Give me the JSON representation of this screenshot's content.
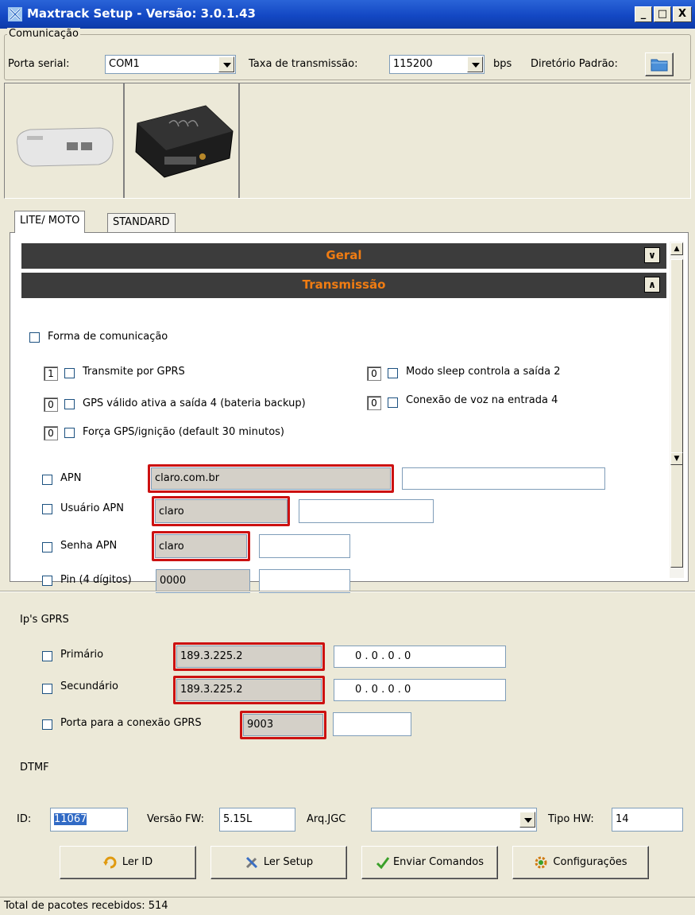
{
  "window": {
    "title": "Maxtrack Setup - Versão: 3.0.1.43",
    "min": "_",
    "max": "□",
    "close": "X"
  },
  "comm": {
    "legend": "Comunicação",
    "porta_label": "Porta serial:",
    "porta_value": "COM1",
    "taxa_label": "Taxa de transmissão:",
    "taxa_value": "115200",
    "bps": "bps",
    "diretorio_label": "Diretório Padrão:"
  },
  "tabs": [
    "LITE/ MOTO",
    "STANDARD"
  ],
  "sections": {
    "geral": "Geral",
    "transmissao": "Transmissão"
  },
  "form": {
    "forma_label": "Forma de comunicação",
    "opts": {
      "gprs": {
        "num": "1",
        "label": "Transmite por GPRS"
      },
      "sleep": {
        "num": "0",
        "label": "Modo sleep controla a saída 2"
      },
      "gps": {
        "num": "0",
        "label": "GPS válido ativa a saída 4 (bateria backup)"
      },
      "voz": {
        "num": "0",
        "label": "Conexão de voz na entrada 4"
      },
      "forca": {
        "num": "0",
        "label": "Força GPS/ignição (default 30 minutos)"
      }
    },
    "apn": {
      "label": "APN",
      "value": "claro.com.br",
      "new": ""
    },
    "usuario": {
      "label": "Usuário APN",
      "value": "claro",
      "new": ""
    },
    "senha": {
      "label": "Senha APN",
      "value": "claro",
      "new": ""
    },
    "pin": {
      "label": "Pin (4 dígitos)",
      "value": "0000",
      "new": ""
    },
    "ips_label": "Ip's GPRS",
    "primario": {
      "label": "Primário",
      "value": "189.3.225.2",
      "new": "0  .  0  .  0  .  0"
    },
    "secundario": {
      "label": "Secundário",
      "value": "189.3.225.2",
      "new": "0  .  0  .  0  .  0"
    },
    "porta": {
      "label": "Porta para a conexão GPRS",
      "value": "9003",
      "new": ""
    },
    "dtmf_label": "DTMF"
  },
  "bottom": {
    "id_label": "ID:",
    "id_value": "11067",
    "fw_label": "Versão FW:",
    "fw_value": "5.15L",
    "jgc_label": "Arq.JGC",
    "jgc_value": "",
    "hw_label": "Tipo HW:",
    "hw_value": "14",
    "buttons": {
      "ler_id": "Ler ID",
      "ler_setup": "Ler Setup",
      "enviar": "Enviar Comandos",
      "config": "Configurações"
    }
  },
  "status": "Total de pacotes recebidos: 514",
  "icons": {
    "app": "maxtrack-app-icon",
    "folder": "folder-icon",
    "device1": "device-white-image",
    "device2": "device-black-image"
  },
  "colors": {
    "section_text": "#f07c12",
    "section_bg": "#3c3c3c",
    "highlight": "#cc1111"
  }
}
